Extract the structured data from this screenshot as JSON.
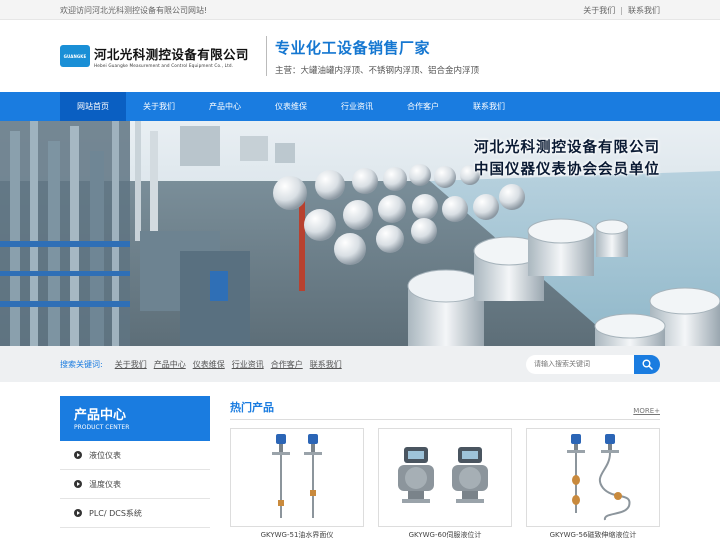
{
  "topbar": {
    "welcome": "欢迎访问河北光科测控设备有限公司网站!",
    "about": "关于我们",
    "sep": "|",
    "contact": "联系我们"
  },
  "header": {
    "logo_mark": "GUANGKE",
    "company_cn": "河北光科测控设备有限公司",
    "company_en": "Hebei Guangke Measurement and Control Equipment Co., Ltd.",
    "slogan": "专业化工设备销售厂家",
    "subslogan": "主营：大罐油罐内浮顶、不锈钢内浮顶、铝合金内浮顶"
  },
  "nav": {
    "items": [
      "网站首页",
      "关于我们",
      "产品中心",
      "仪表维保",
      "行业资讯",
      "合作客户",
      "联系我们"
    ],
    "active_index": 0
  },
  "banner": {
    "line1": "河北光科测控设备有限公司",
    "line2": "中国仪器仪表协会会员单位"
  },
  "search": {
    "label": "搜索关键词:",
    "keywords": [
      "关于我们",
      "产品中心",
      "仪表维保",
      "行业资讯",
      "合作客户",
      "联系我们"
    ],
    "placeholder": "请输入搜索关键词",
    "button_icon": "search-icon"
  },
  "sidebar": {
    "title": "产品中心",
    "subtitle": "PRODUCT CENTER",
    "items": [
      "液位仪表",
      "温度仪表",
      "PLC/ DCS系统"
    ]
  },
  "hot": {
    "title": "热门产品",
    "more": "MORE+",
    "products": [
      {
        "name": "GKYWG-51油水界面仪"
      },
      {
        "name": "GKYWG-60伺服液位计"
      },
      {
        "name": "GKYWG-56磁致伸缩液位计"
      }
    ]
  },
  "colors": {
    "brand_blue": "#1a7ce0",
    "nav_active": "#0a5fc2"
  }
}
